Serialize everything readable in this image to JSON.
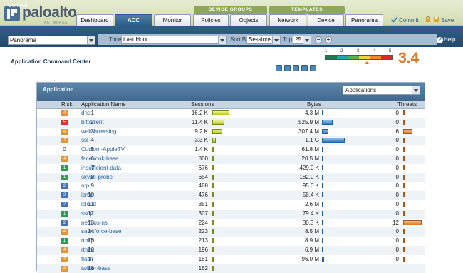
{
  "brand": {
    "name": "paloalto",
    "tagline": "NETWORKS"
  },
  "header": {
    "group_labels": [
      "DEVICE GROUPS",
      "TEMPLATES"
    ],
    "tabs": [
      "Dashboard",
      "ACC",
      "Monitor",
      "Policies",
      "Objects",
      "Network",
      "Device",
      "Panorama"
    ],
    "active_tab": "ACC",
    "commit_label": "Commit",
    "save_label": "Save"
  },
  "context": {
    "label": "Context",
    "value": "Panorama"
  },
  "filters": {
    "time_label": "Time",
    "time_value": "Last Hour",
    "sort_label": "Sort By",
    "sort_value": "Sessions",
    "top_label": "Top",
    "top_value": "25",
    "help_label": "Help"
  },
  "page_title": "Application Command Center",
  "risk_meter": {
    "scale": [
      "1",
      "2",
      "3",
      "4",
      "5"
    ],
    "score": "3.4",
    "colors": [
      "#1f7a4a",
      "#2aa0b8",
      "#58b14a",
      "#e8d43a",
      "#ea8a2a",
      "#d52b20"
    ]
  },
  "panel": {
    "title": "Application",
    "view_select": "Applications",
    "columns": [
      "Risk",
      "Application Name",
      "Sessions",
      "Bytes",
      "Threats"
    ]
  },
  "risk_colors": {
    "1": "#2e9a52",
    "2": "#3f70b8",
    "3": "#d9b826",
    "4": "#e59435",
    "5": "#d4322a"
  },
  "rows": [
    {
      "idx": "1",
      "risk": "4",
      "name": "dns",
      "sessions": "16.2 K",
      "sess_frac": 1.0,
      "bytes": "4.3 M",
      "bytes_frac": 0.004,
      "threats": "0",
      "thr_frac": 0
    },
    {
      "idx": "2",
      "risk": "5",
      "name": "bittorrent",
      "sessions": "11.4 K",
      "sess_frac": 0.7,
      "bytes": "525.9 M",
      "bytes_frac": 0.47,
      "threats": "0",
      "thr_frac": 0
    },
    {
      "idx": "3",
      "risk": "4",
      "name": "web-browsing",
      "sessions": "9.2 K",
      "sess_frac": 0.57,
      "bytes": "307.4 M",
      "bytes_frac": 0.28,
      "threats": "6",
      "thr_frac": 0.5
    },
    {
      "idx": "4",
      "risk": "4",
      "name": "ssl",
      "sessions": "3.3 K",
      "sess_frac": 0.2,
      "bytes": "1.1 G",
      "bytes_frac": 1.0,
      "threats": "0",
      "thr_frac": 0
    },
    {
      "idx": "5",
      "risk": "0",
      "name": "Custom-AppleTV",
      "sessions": "1.4 K",
      "sess_frac": 0.09,
      "bytes": "61.8 M",
      "bytes_frac": 0.056,
      "threats": "0",
      "thr_frac": 0
    },
    {
      "idx": "6",
      "risk": "4",
      "name": "facebook-base",
      "sessions": "800",
      "sess_frac": 0.05,
      "bytes": "20.5 M",
      "bytes_frac": 0.019,
      "threats": "0",
      "thr_frac": 0
    },
    {
      "idx": "7",
      "risk": "1",
      "name": "insufficient-data",
      "sessions": "676",
      "sess_frac": 0.04,
      "bytes": "429.0 K",
      "bytes_frac": 0.0004,
      "threats": "0",
      "thr_frac": 0
    },
    {
      "idx": "8",
      "risk": "1",
      "name": "skype-probe",
      "sessions": "654",
      "sess_frac": 0.04,
      "bytes": "182.0 K",
      "bytes_frac": 0.0002,
      "threats": "0",
      "thr_frac": 0
    },
    {
      "idx": "9",
      "risk": "2",
      "name": "ntp",
      "sessions": "488",
      "sess_frac": 0.03,
      "bytes": "95.0 K",
      "bytes_frac": 0.0001,
      "threats": "0",
      "thr_frac": 0
    },
    {
      "idx": "10",
      "risk": "2",
      "name": "icmp",
      "sessions": "476",
      "sess_frac": 0.03,
      "bytes": "58.4 K",
      "bytes_frac": 0.0001,
      "threats": "0",
      "thr_frac": 0
    },
    {
      "idx": "11",
      "risk": "2",
      "name": "icloud",
      "sessions": "351",
      "sess_frac": 0.02,
      "bytes": "2.6 M",
      "bytes_frac": 0.002,
      "threats": "0",
      "thr_frac": 0
    },
    {
      "idx": "12",
      "risk": "1",
      "name": "ssdp",
      "sessions": "307",
      "sess_frac": 0.02,
      "bytes": "79.4 K",
      "bytes_frac": 0.0001,
      "threats": "0",
      "thr_frac": 0
    },
    {
      "idx": "13",
      "risk": "2",
      "name": "netbios-ns",
      "sessions": "224",
      "sess_frac": 0.014,
      "bytes": "30.3 K",
      "bytes_frac": 0.0001,
      "threats": "12",
      "thr_frac": 1.0
    },
    {
      "idx": "14",
      "risk": "4",
      "name": "salesforce-base",
      "sessions": "223",
      "sess_frac": 0.014,
      "bytes": "8.5 M",
      "bytes_frac": 0.008,
      "threats": "0",
      "thr_frac": 0
    },
    {
      "idx": "15",
      "risk": "1",
      "name": "rtmfp",
      "sessions": "213",
      "sess_frac": 0.013,
      "bytes": "8.9 M",
      "bytes_frac": 0.008,
      "threats": "0",
      "thr_frac": 0
    },
    {
      "idx": "16",
      "risk": "4",
      "name": "rtmpt",
      "sessions": "196",
      "sess_frac": 0.012,
      "bytes": "6.9 M",
      "bytes_frac": 0.006,
      "threats": "0",
      "thr_frac": 0
    },
    {
      "idx": "17",
      "risk": "4",
      "name": "flash",
      "sessions": "181",
      "sess_frac": 0.011,
      "bytes": "96.0 M",
      "bytes_frac": 0.087,
      "threats": "0",
      "thr_frac": 0
    },
    {
      "idx": "18",
      "risk": "4",
      "name": "twitter-base",
      "sessions": "162",
      "sess_frac": 0.01,
      "bytes": "",
      "bytes_frac": 0,
      "threats": "",
      "thr_frac": 0
    }
  ]
}
